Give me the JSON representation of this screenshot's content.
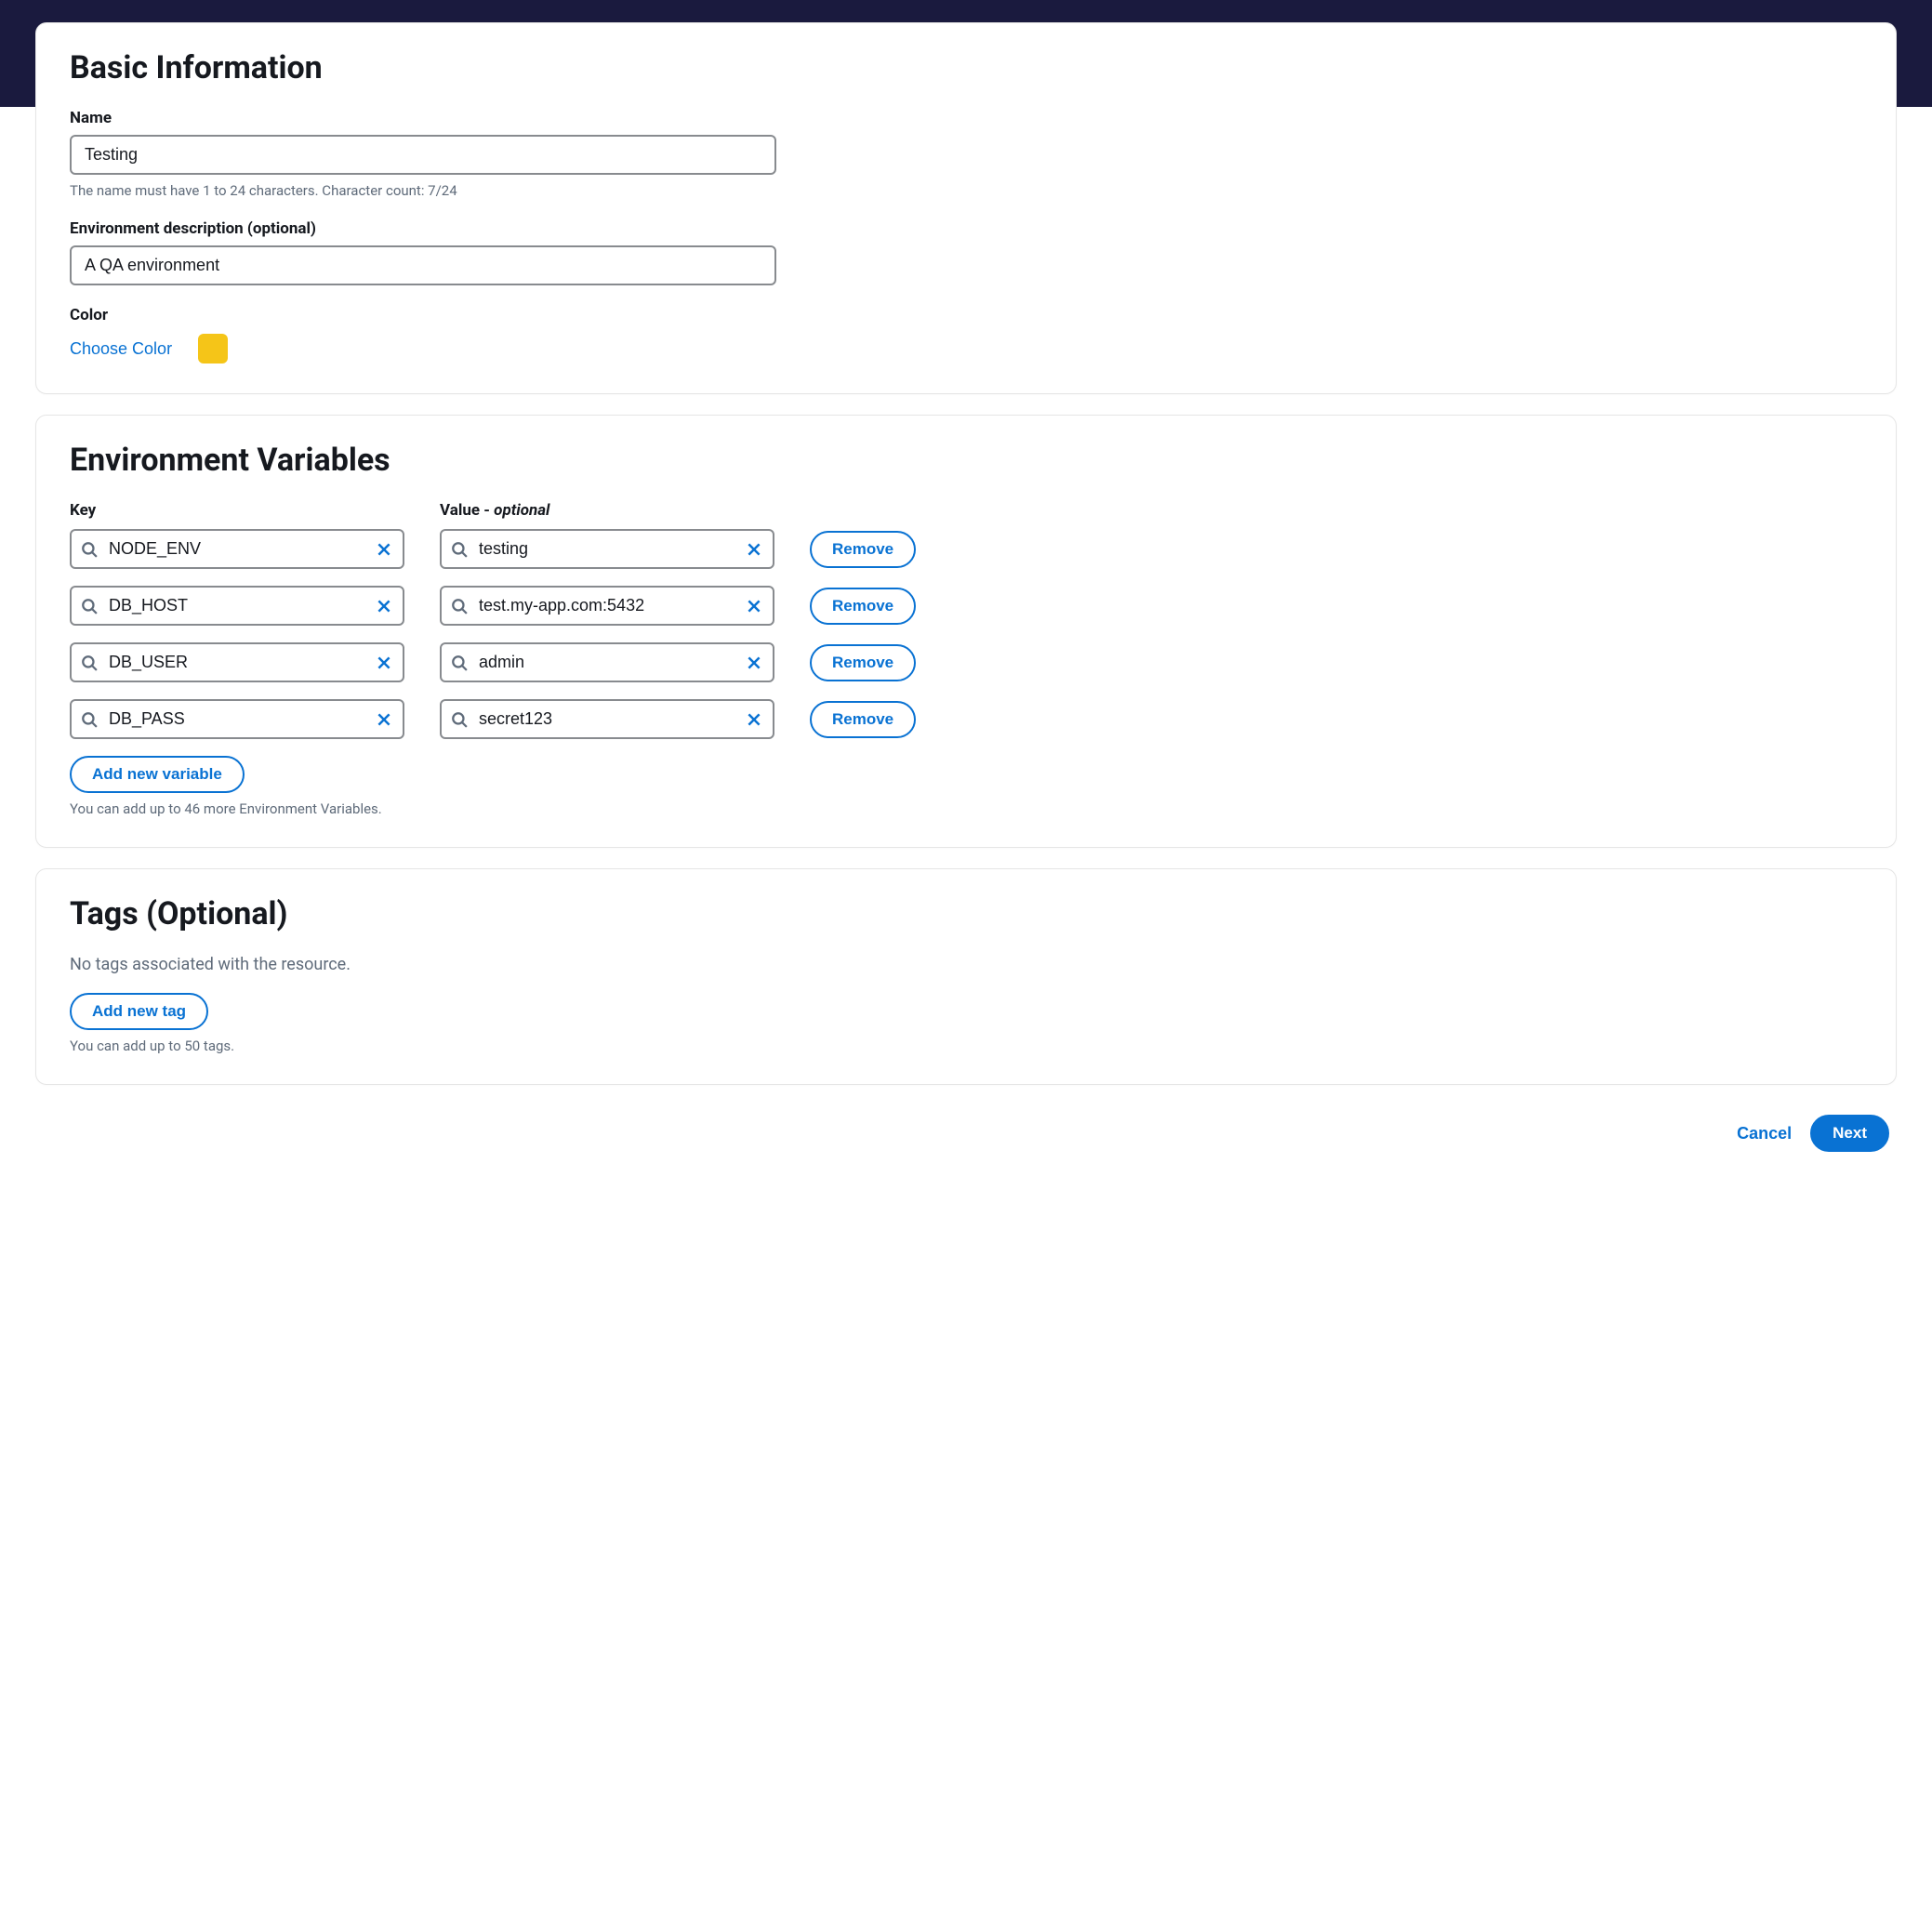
{
  "basic": {
    "section_title": "Basic Information",
    "name_label": "Name",
    "name_value": "Testing",
    "name_help": "The name must have 1 to 24 characters. Character count: 7/24",
    "desc_label": "Environment description (optional)",
    "desc_value": "A QA environment",
    "color_label": "Color",
    "choose_color": "Choose Color",
    "color_value": "#f5c518"
  },
  "env_vars": {
    "section_title": "Environment Variables",
    "key_label": "Key",
    "value_label_prefix": "Value - ",
    "value_label_optional": "optional",
    "remove_label": "Remove",
    "add_label": "Add new variable",
    "help": "You can add up to 46 more Environment Variables.",
    "rows": [
      {
        "key": "NODE_ENV",
        "value": "testing"
      },
      {
        "key": "DB_HOST",
        "value": "test.my-app.com:5432"
      },
      {
        "key": "DB_USER",
        "value": "admin"
      },
      {
        "key": "DB_PASS",
        "value": "secret123"
      }
    ]
  },
  "tags": {
    "section_title": "Tags (Optional)",
    "empty_text": "No tags associated with the resource.",
    "add_label": "Add new tag",
    "help": "You can add up to 50 tags."
  },
  "footer": {
    "cancel": "Cancel",
    "next": "Next"
  }
}
